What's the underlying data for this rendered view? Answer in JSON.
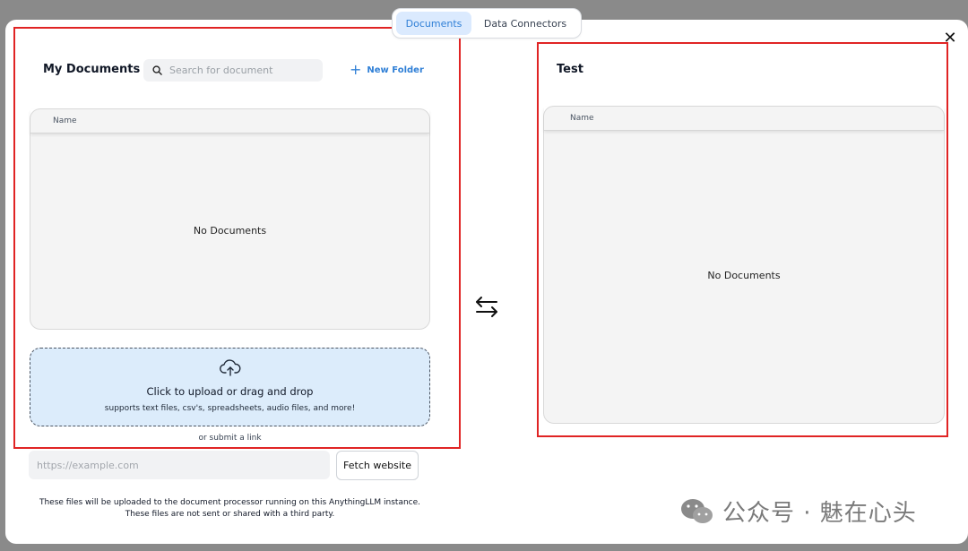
{
  "tabs": [
    {
      "label": "Documents",
      "active": true
    },
    {
      "label": "Data Connectors",
      "active": false
    }
  ],
  "left_panel": {
    "title": "My Documents",
    "search_placeholder": "Search for document",
    "new_folder_label": "New Folder",
    "table_header": "Name",
    "empty_text": "No Documents"
  },
  "upload": {
    "title": "Click to upload or drag and drop",
    "subtitle": "supports text files, csv's, spreadsheets, audio files, and more!",
    "or_link_text": "or submit a link"
  },
  "link_form": {
    "url_placeholder": "https://example.com",
    "fetch_button": "Fetch website"
  },
  "note": {
    "line1": "These files will be uploaded to the document processor running on this AnythingLLM instance.",
    "line2": "These files are not sent or shared with a third party."
  },
  "right_panel": {
    "title": "Test",
    "table_header": "Name",
    "empty_text": "No Documents"
  },
  "watermark": {
    "text": "公众号 · 魅在心头",
    "icon": "wechat-icon"
  },
  "icons": {
    "search": "search-icon",
    "plus": "plus-icon",
    "upload": "cloud-upload-icon",
    "swap": "swap-arrows-icon",
    "close": "close-icon"
  },
  "colors": {
    "accent": "#2f7fd6",
    "active_tab_bg": "#dbeafe",
    "upload_bg": "#dcecfb",
    "highlight_border": "#e02424"
  }
}
